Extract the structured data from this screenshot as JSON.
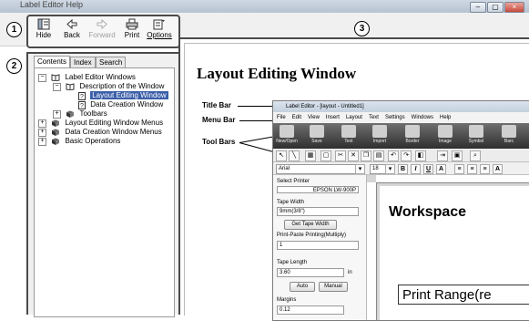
{
  "window": {
    "title": "Label Editor Help"
  },
  "window_controls": {
    "minimize": "–",
    "maximize": "▢",
    "close": "×"
  },
  "callouts": [
    "1",
    "2",
    "3"
  ],
  "toolbar": {
    "hide": "Hide",
    "back": "Back",
    "forward": "Forward",
    "print": "Print",
    "options": "Options"
  },
  "nav": {
    "tabs": [
      "Contents",
      "Index",
      "Search"
    ],
    "tree": [
      {
        "label": "Label Editor Windows",
        "expander": "−",
        "icon": "book-open-icon"
      },
      {
        "label": "Description of the Window",
        "expander": "−",
        "icon": "book-open-icon"
      },
      {
        "label": "Layout Editing Window",
        "icon": "help-page-icon",
        "selected": true
      },
      {
        "label": "Data Creation Window",
        "icon": "help-page-icon"
      },
      {
        "label": "Toolbars",
        "expander": "+",
        "icon": "book-closed-icon"
      },
      {
        "label": "Layout Editing Window Menus",
        "expander": "+",
        "icon": "book-closed-icon"
      },
      {
        "label": "Data Creation Window Menus",
        "expander": "+",
        "icon": "book-closed-icon"
      },
      {
        "label": "Basic Operations",
        "expander": "+",
        "icon": "book-closed-icon"
      }
    ]
  },
  "content": {
    "heading": "Layout Editing Window",
    "annotations": {
      "title_bar": "Title Bar",
      "menu_bar": "Menu Bar",
      "tool_bars": "Tool Bars"
    },
    "screenshot": {
      "title": "Label Editor - [layout - Untitled1]",
      "menu": [
        "File",
        "Edit",
        "View",
        "Insert",
        "Layout",
        "Text",
        "Settings",
        "Windows",
        "Help"
      ],
      "big_buttons": [
        "New/Open",
        "Save",
        "Text",
        "Import",
        "Border",
        "Image",
        "Symbol",
        "Barc"
      ],
      "font_name": "Arial",
      "font_size": "18",
      "format_buttons": [
        "B",
        "I",
        "U",
        "A"
      ],
      "panel": {
        "select_printer": "Select Printer",
        "printer": "EPSON LW-900P",
        "tape_width_label": "Tape Width",
        "tape_width_value": "9mm(3/8\")",
        "get_tape_width": "Get Tape Width",
        "print_paste_label": "Print-Paste Printing(Multiply)",
        "print_paste_value": "1",
        "tape_length_label": "Tape Length",
        "tape_length_value": "3.60",
        "unit": "in",
        "auto": "Auto",
        "manual": "Manual",
        "margins_label": "Margins",
        "margins_value": "0.12"
      },
      "workspace": "Workspace",
      "print_range": "Print Range(re"
    }
  }
}
